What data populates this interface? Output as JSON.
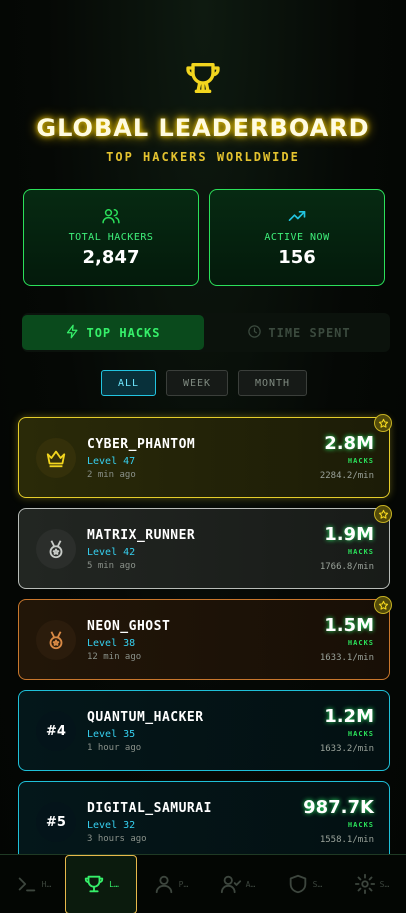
{
  "header": {
    "icon": "trophy-icon",
    "title": "GLOBAL LEADERBOARD",
    "subtitle": "TOP HACKERS WORLDWIDE"
  },
  "stats": [
    {
      "icon": "users-icon",
      "label": "TOTAL HACKERS",
      "value": "2,847"
    },
    {
      "icon": "trending-up-icon",
      "label": "ACTIVE NOW",
      "value": "156"
    }
  ],
  "view_toggle": {
    "active": {
      "icon": "lightning-icon",
      "label": "TOP HACKS"
    },
    "inactive": {
      "icon": "clock-icon",
      "label": "TIME SPENT"
    }
  },
  "filters": [
    {
      "label": "ALL",
      "selected": true
    },
    {
      "label": "WEEK",
      "selected": false
    },
    {
      "label": "MONTH",
      "selected": false
    }
  ],
  "leaders": [
    {
      "rank": "1",
      "badge_icon": "crown-icon",
      "name": "CYBER_PHANTOM",
      "level": "Level 47",
      "ago": "2 min ago",
      "score": "2.8M",
      "unit": "HACKS",
      "rate": "2284.2/min",
      "starred": true
    },
    {
      "rank": "2",
      "badge_icon": "medal-silver-icon",
      "name": "MATRIX_RUNNER",
      "level": "Level 42",
      "ago": "5 min ago",
      "score": "1.9M",
      "unit": "HACKS",
      "rate": "1766.8/min",
      "starred": true
    },
    {
      "rank": "3",
      "badge_icon": "medal-bronze-icon",
      "name": "NEON_GHOST",
      "level": "Level 38",
      "ago": "12 min ago",
      "score": "1.5M",
      "unit": "HACKS",
      "rate": "1633.1/min",
      "starred": true
    },
    {
      "rank": "#4",
      "badge_icon": "",
      "name": "QUANTUM_HACKER",
      "level": "Level 35",
      "ago": "1 hour ago",
      "score": "1.2M",
      "unit": "HACKS",
      "rate": "1633.2/min",
      "starred": false
    },
    {
      "rank": "#5",
      "badge_icon": "",
      "name": "DIGITAL_SAMURAI",
      "level": "Level 32",
      "ago": "3 hours ago",
      "score": "987.7K",
      "unit": "HACKS",
      "rate": "1558.1/min",
      "starred": false
    }
  ],
  "tabbar": [
    {
      "icon": "terminal-icon",
      "label": "H…",
      "active": false
    },
    {
      "icon": "trophy-icon",
      "label": "L…",
      "active": true
    },
    {
      "icon": "user-icon",
      "label": "P…",
      "active": false
    },
    {
      "icon": "user-check-icon",
      "label": "A…",
      "active": false
    },
    {
      "icon": "shield-icon",
      "label": "S…",
      "active": false
    },
    {
      "icon": "settings-icon",
      "label": "S…",
      "active": false
    }
  ],
  "colors": {
    "accent_green": "#2be05a",
    "gold": "#e5cd2a",
    "silver": "#b8bcb8",
    "bronze": "#c9772d",
    "cyan": "#1fc0d8"
  }
}
